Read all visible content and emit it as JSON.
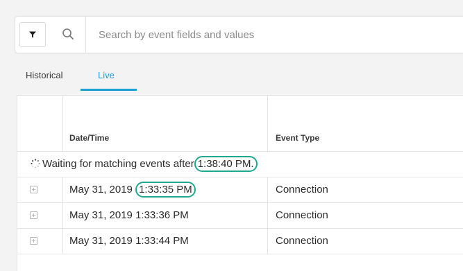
{
  "search": {
    "placeholder": "Search by event fields and values"
  },
  "icons": {
    "filter": "filter-icon",
    "search": "search-icon",
    "spinner": "loading-spinner-icon",
    "expand": "expand-plus-icon"
  },
  "colors": {
    "accent": "#1a9fd5",
    "highlight": "#1fa88e"
  },
  "tabs": [
    {
      "label": "Historical",
      "active": false
    },
    {
      "label": "Live",
      "active": true
    }
  ],
  "table": {
    "columns": [
      "Date/Time",
      "Event Type"
    ],
    "status": {
      "prefix": "Waiting for matching events after",
      "time": "1:38:40 PM."
    },
    "rows": [
      {
        "date": "May 31, 2019",
        "time": "1:33:35 PM",
        "event_type": "Connection"
      },
      {
        "date": "May 31, 2019",
        "time": "1:33:36 PM",
        "event_type": "Connection"
      },
      {
        "date": "May 31, 2019",
        "time": "1:33:44 PM",
        "event_type": "Connection"
      }
    ]
  }
}
